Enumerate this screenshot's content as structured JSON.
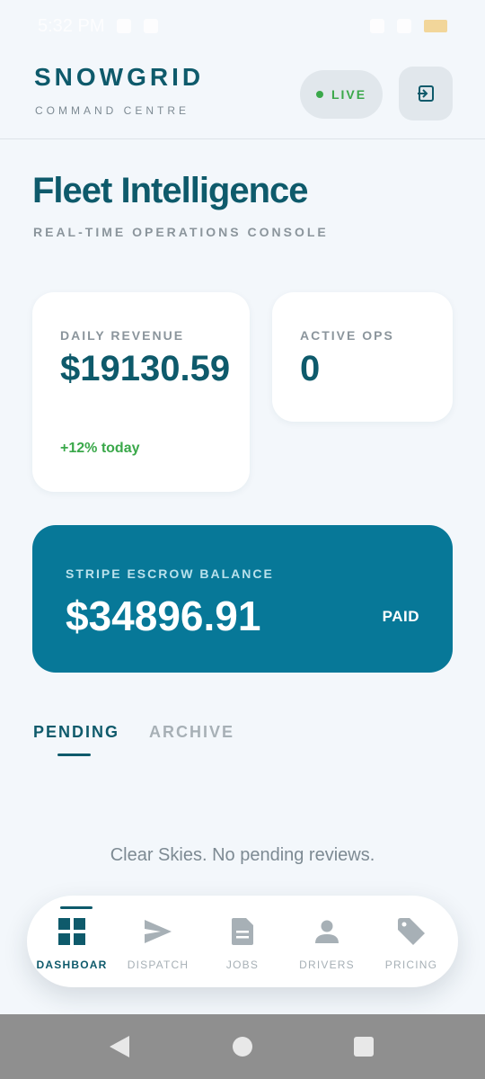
{
  "status_bar": {
    "time": "5:32 PM"
  },
  "header": {
    "brand": "SNOWGRID",
    "subtitle": "COMMAND CENTRE",
    "live_label": "LIVE",
    "live_color": "#3aa84a",
    "exit_icon": "exit-to-app-icon"
  },
  "page": {
    "title": "Fleet Intelligence",
    "subtitle": "REAL-TIME OPERATIONS CONSOLE"
  },
  "stats": {
    "revenue": {
      "label": "DAILY REVENUE",
      "value": "$19130.59",
      "delta": "+12% today"
    },
    "active_ops": {
      "label": "ACTIVE OPS",
      "value": "0"
    }
  },
  "escrow": {
    "label": "STRIPE ESCROW BALANCE",
    "amount": "$34896.91",
    "status": "PAID",
    "background": "#077898"
  },
  "tabs": [
    {
      "label": "PENDING",
      "active": true
    },
    {
      "label": "ARCHIVE",
      "active": false
    }
  ],
  "empty_state": "Clear Skies. No pending reviews.",
  "bottom_nav": [
    {
      "label": "DASHBOAR",
      "icon": "dashboard-icon",
      "active": true
    },
    {
      "label": "DISPATCH",
      "icon": "send-icon",
      "active": false
    },
    {
      "label": "JOBS",
      "icon": "document-icon",
      "active": false
    },
    {
      "label": "DRIVERS",
      "icon": "person-icon",
      "active": false
    },
    {
      "label": "PRICING",
      "icon": "tag-icon",
      "active": false
    }
  ],
  "colors": {
    "primary": "#0e5a6b",
    "background": "#f3f7fb",
    "muted": "#8b959c",
    "success": "#3aa84a"
  }
}
